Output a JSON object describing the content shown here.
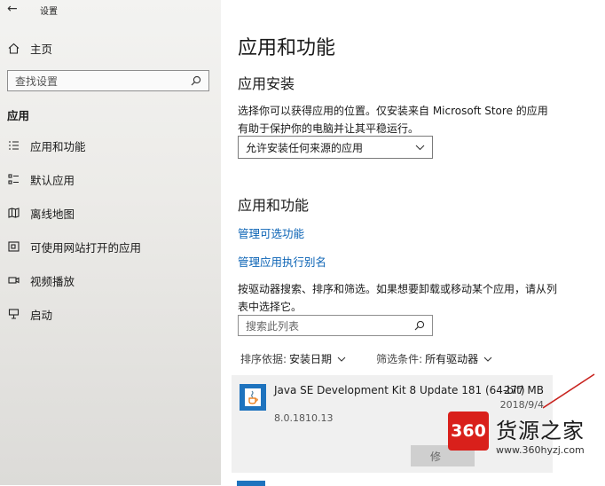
{
  "window": {
    "title": "设置"
  },
  "sidebar": {
    "home_label": "主页",
    "search_placeholder": "查找设置",
    "section_label": "应用",
    "items": [
      {
        "label": "应用和功能",
        "icon": "apps-list-icon"
      },
      {
        "label": "默认应用",
        "icon": "default-apps-icon"
      },
      {
        "label": "离线地图",
        "icon": "offline-maps-icon"
      },
      {
        "label": "可使用网站打开的应用",
        "icon": "websites-apps-icon"
      },
      {
        "label": "视频播放",
        "icon": "video-playback-icon"
      },
      {
        "label": "启动",
        "icon": "startup-icon"
      }
    ]
  },
  "main": {
    "title": "应用和功能",
    "install_heading": "应用安装",
    "install_desc": "选择你可以获得应用的位置。仅安装来自 Microsoft Store 的应用有助于保护你的电脑并让其平稳运行。",
    "install_dropdown_value": "允许安装任何来源的应用",
    "apps_heading": "应用和功能",
    "link_optional": "管理可选功能",
    "link_alias": "管理应用执行别名",
    "list_desc": "按驱动器搜索、排序和筛选。如果想要卸载或移动某个应用，请从列表中选择它。",
    "list_search_placeholder": "搜索此列表",
    "sort_label": "排序依据:",
    "sort_value": "安装日期",
    "filter_label": "筛选条件:",
    "filter_value": "所有驱动器",
    "app": {
      "name": "Java SE Development Kit 8 Update 181 (64-bit)",
      "size": "277 MB",
      "date": "2018/9/4",
      "version": "8.0.1810.13",
      "modify_label": "修"
    }
  },
  "watermark": {
    "logo_text": "360",
    "name": "货源之家",
    "url": "www.360hyzj.com"
  },
  "colors": {
    "link": "#0b63b5",
    "java_icon_bg": "#1e73be",
    "watermark_red": "#d9201b"
  }
}
